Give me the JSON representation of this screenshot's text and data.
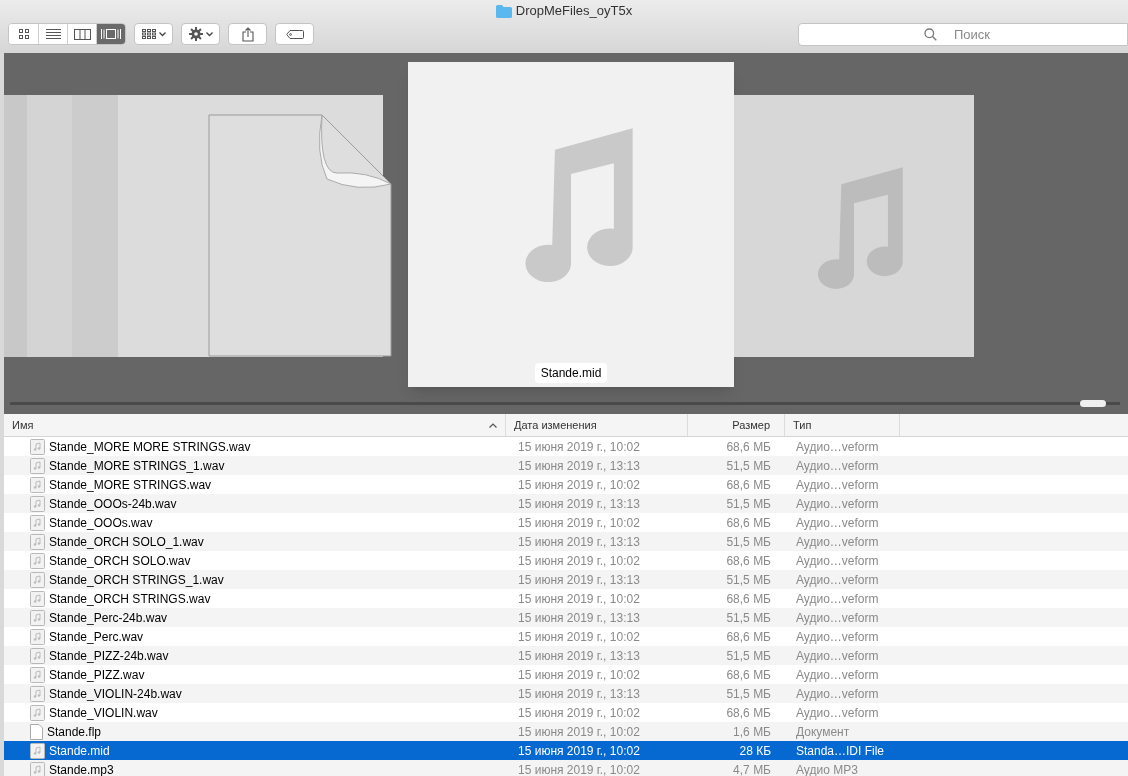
{
  "window": {
    "title": "DropMeFiles_oyT5x"
  },
  "view_buttons": [
    {
      "kind": "icons",
      "selected": false
    },
    {
      "kind": "list",
      "selected": false
    },
    {
      "kind": "columns",
      "selected": false
    },
    {
      "kind": "coverflow",
      "selected": true
    }
  ],
  "search": {
    "placeholder": "Поиск"
  },
  "coverflow": {
    "caption": "Stande.mid",
    "items": [
      {
        "kind": "document"
      },
      {
        "kind": "audio",
        "selected": true
      },
      {
        "kind": "audio"
      }
    ]
  },
  "table": {
    "columns": [
      {
        "label": "Имя",
        "sorted": true
      },
      {
        "label": "Дата изменения",
        "sorted": false
      },
      {
        "label": "Размер",
        "sorted": false
      },
      {
        "label": "Тип",
        "sorted": false
      }
    ],
    "rows": [
      {
        "kind": "audio",
        "name": "Stande_MORE MORE STRINGS.wav",
        "date": "15 июня 2019 г., 10:02",
        "size": "68,6 МБ",
        "type": "Аудио…veform",
        "selected": false
      },
      {
        "kind": "audio",
        "name": "Stande_MORE STRINGS_1.wav",
        "date": "15 июня 2019 г., 13:13",
        "size": "51,5 МБ",
        "type": "Аудио…veform",
        "selected": false
      },
      {
        "kind": "audio",
        "name": "Stande_MORE STRINGS.wav",
        "date": "15 июня 2019 г., 10:02",
        "size": "68,6 МБ",
        "type": "Аудио…veform",
        "selected": false
      },
      {
        "kind": "audio",
        "name": "Stande_OOOs-24b.wav",
        "date": "15 июня 2019 г., 13:13",
        "size": "51,5 МБ",
        "type": "Аудио…veform",
        "selected": false
      },
      {
        "kind": "audio",
        "name": "Stande_OOOs.wav",
        "date": "15 июня 2019 г., 10:02",
        "size": "68,6 МБ",
        "type": "Аудио…veform",
        "selected": false
      },
      {
        "kind": "audio",
        "name": "Stande_ORCH SOLO_1.wav",
        "date": "15 июня 2019 г., 13:13",
        "size": "51,5 МБ",
        "type": "Аудио…veform",
        "selected": false
      },
      {
        "kind": "audio",
        "name": "Stande_ORCH SOLO.wav",
        "date": "15 июня 2019 г., 10:02",
        "size": "68,6 МБ",
        "type": "Аудио…veform",
        "selected": false
      },
      {
        "kind": "audio",
        "name": "Stande_ORCH STRINGS_1.wav",
        "date": "15 июня 2019 г., 13:13",
        "size": "51,5 МБ",
        "type": "Аудио…veform",
        "selected": false
      },
      {
        "kind": "audio",
        "name": "Stande_ORCH STRINGS.wav",
        "date": "15 июня 2019 г., 10:02",
        "size": "68,6 МБ",
        "type": "Аудио…veform",
        "selected": false
      },
      {
        "kind": "audio",
        "name": "Stande_Perc-24b.wav",
        "date": "15 июня 2019 г., 13:13",
        "size": "51,5 МБ",
        "type": "Аудио…veform",
        "selected": false
      },
      {
        "kind": "audio",
        "name": "Stande_Perc.wav",
        "date": "15 июня 2019 г., 10:02",
        "size": "68,6 МБ",
        "type": "Аудио…veform",
        "selected": false
      },
      {
        "kind": "audio",
        "name": "Stande_PIZZ-24b.wav",
        "date": "15 июня 2019 г., 13:13",
        "size": "51,5 МБ",
        "type": "Аудио…veform",
        "selected": false
      },
      {
        "kind": "audio",
        "name": "Stande_PIZZ.wav",
        "date": "15 июня 2019 г., 10:02",
        "size": "68,6 МБ",
        "type": "Аудио…veform",
        "selected": false
      },
      {
        "kind": "audio",
        "name": "Stande_VIOLIN-24b.wav",
        "date": "15 июня 2019 г., 13:13",
        "size": "51,5 МБ",
        "type": "Аудио…veform",
        "selected": false
      },
      {
        "kind": "audio",
        "name": "Stande_VIOLIN.wav",
        "date": "15 июня 2019 г., 10:02",
        "size": "68,6 МБ",
        "type": "Аудио…veform",
        "selected": false
      },
      {
        "kind": "document",
        "name": "Stande.flp",
        "date": "15 июня 2019 г., 10:02",
        "size": "1,6 МБ",
        "type": "Документ",
        "selected": false
      },
      {
        "kind": "audio",
        "name": "Stande.mid",
        "date": "15 июня 2019 г., 10:02",
        "size": "28 КБ",
        "type": "Standa…IDI File",
        "selected": true
      },
      {
        "kind": "audio",
        "name": "Stande.mp3",
        "date": "15 июня 2019 г., 10:02",
        "size": "4,7 МБ",
        "type": "Аудио MP3",
        "selected": false
      }
    ]
  }
}
